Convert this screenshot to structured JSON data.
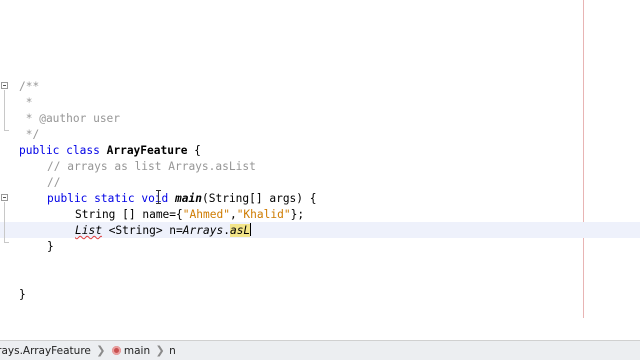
{
  "code_lines": [
    "/**",
    " *",
    " * @author user",
    " */",
    "public class ArrayFeature {",
    "// arrays as list Arrays.asList",
    "//",
    "public static void main(String[] args) {",
    "String [] name={\"Ahmed\",\"Khalid\"};",
    "List <String> n=Arrays.asL",
    "}",
    "}"
  ],
  "tokens": {
    "public": "public",
    "class": "class",
    "class_name": "ArrayFeature",
    "open_brace": " {",
    "static": "static",
    "void": "void",
    "main": "main",
    "params": "(String[] args) {",
    "string_decl": "String [] name={",
    "ahmed": "\"Ahmed\"",
    "comma": ",",
    "khalid": "\"Khalid\"",
    "end_decl": "};",
    "list": "List",
    "list_rest": " <String> n=",
    "arrays": "Arrays",
    "dot": ".",
    "asl": "asL",
    "close_brace": "}"
  },
  "statusbar": {
    "crumbs": [
      "rrays.ArrayFeature",
      "main",
      "n"
    ]
  },
  "colors": {
    "keyword": "#0000e6",
    "comment": "#969696",
    "string": "#ce7b00",
    "error": "#e03c3c",
    "current_line": "#eef1fb"
  },
  "icons": [
    "fold-icon",
    "method-icon",
    "breadcrumb-separator-icon",
    "text-cursor-icon"
  ]
}
